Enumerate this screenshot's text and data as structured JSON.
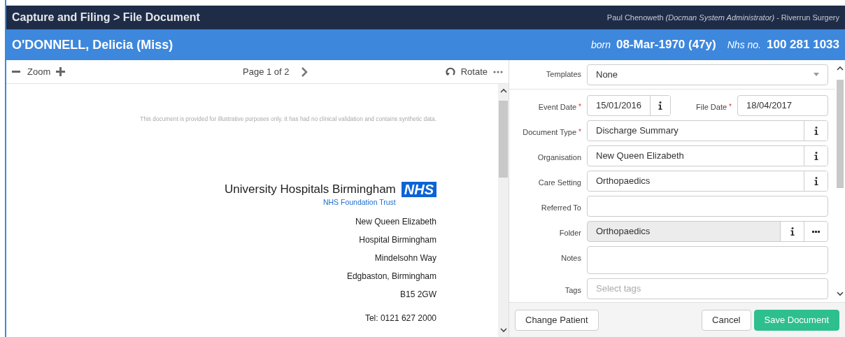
{
  "header": {
    "breadcrumb": "Capture and Filing > File Document",
    "user": "Paul Chenoweth",
    "role": "(Docman System Administrator)",
    "practice": "- Riverrun Surgery"
  },
  "patient": {
    "name": "O'DONNELL, Delicia (Miss)",
    "born_label": "born",
    "dob": "08-Mar-1970 (47y)",
    "nhs_label": "Nhs no.",
    "nhs_no": "100 281 1033"
  },
  "viewer_toolbar": {
    "zoom_label": "Zoom",
    "page_label": "Page 1 of 2",
    "rotate_label": "Rotate"
  },
  "document": {
    "disclaimer": "This document is provided for illustrative purposes only. It has had no clinical validation and contains synthetic data.",
    "trust_name": "University Hospitals Birmingham",
    "trust_badge": "NHS",
    "trust_subtitle": "NHS Foundation Trust",
    "address_lines": [
      "New Queen Elizabeth",
      "Hospital Birmingham",
      "Mindelsohn Way",
      "Edgbaston, Birmingham",
      "B15 2GW"
    ],
    "phone": "Tel: 0121 627 2000"
  },
  "templates": {
    "label": "Templates",
    "value": "None"
  },
  "form_rows": [
    {
      "fields": [
        {
          "label": "Event Date",
          "required_mark": "*",
          "value": "15/01/2016",
          "info": true,
          "more": false,
          "readonly": false,
          "multiline": false
        },
        {
          "label": "File Date",
          "required_mark": "*",
          "value": "18/04/2017",
          "info": false,
          "more": false,
          "readonly": false,
          "multiline": false
        }
      ]
    },
    {
      "fields": [
        {
          "label": "Document Type",
          "required_mark": "*",
          "value": "Discharge Summary",
          "info": true,
          "more": false,
          "readonly": false,
          "multiline": false
        }
      ]
    },
    {
      "fields": [
        {
          "label": "Organisation",
          "value": "New Queen Elizabeth",
          "info": true,
          "more": false,
          "readonly": false,
          "multiline": false
        }
      ]
    },
    {
      "fields": [
        {
          "label": "Care Setting",
          "value": "Orthopaedics",
          "info": true,
          "more": false,
          "readonly": false,
          "multiline": false
        }
      ]
    },
    {
      "fields": [
        {
          "label": "Referred To",
          "info": false,
          "more": false,
          "readonly": false,
          "multiline": false
        }
      ]
    },
    {
      "fields": [
        {
          "label": "Folder",
          "value": "Orthopaedics",
          "info": true,
          "more": true,
          "readonly": true,
          "multiline": false
        }
      ]
    },
    {
      "fields": [
        {
          "label": "Notes",
          "info": false,
          "more": false,
          "readonly": false,
          "multiline": true
        }
      ]
    },
    {
      "fields": [
        {
          "label": "Tags",
          "placeholder": "Select tags",
          "info": false,
          "more": false,
          "readonly": false,
          "multiline": false
        }
      ]
    }
  ],
  "footer": {
    "left": [
      {
        "label": "Change Patient",
        "kind": "default"
      }
    ],
    "right": [
      {
        "label": "Cancel",
        "kind": "default"
      },
      {
        "label": "Save Document",
        "kind": "primary"
      }
    ]
  }
}
